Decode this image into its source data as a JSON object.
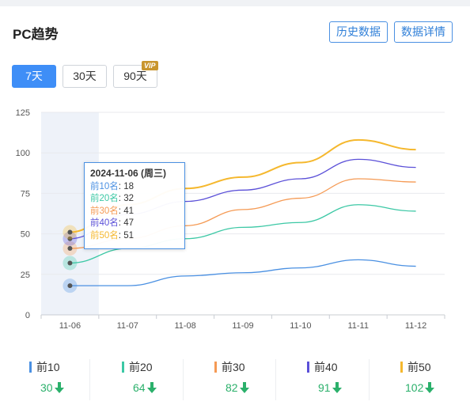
{
  "header": {
    "title": "PC趋势",
    "history_btn": "历史数据",
    "detail_btn": "数据详情"
  },
  "range": {
    "options": [
      "7天",
      "30天",
      "90天"
    ],
    "active": "7天",
    "vip_badge": "VIP"
  },
  "colors": {
    "top10": "#4a90e2",
    "top20": "#3cc8a5",
    "top30": "#f59a54",
    "top40": "#5b50d8",
    "top50": "#f5b82e",
    "primary": "#3e8ef7",
    "down_arrow": "#2bb06b"
  },
  "chart_data": {
    "type": "line",
    "x": [
      "11-06",
      "11-07",
      "11-08",
      "11-09",
      "11-10",
      "11-11",
      "11-12"
    ],
    "ylim": [
      0,
      125
    ],
    "yticks": [
      0,
      25,
      50,
      75,
      100,
      125
    ],
    "highlighted_category": "11-06",
    "series": [
      {
        "name": "前10名",
        "values": [
          18,
          18,
          24,
          26,
          29,
          34,
          30
        ]
      },
      {
        "name": "前20名",
        "values": [
          32,
          41,
          47,
          54,
          57,
          68,
          64
        ]
      },
      {
        "name": "前30名",
        "values": [
          41,
          47,
          55,
          65,
          72,
          84,
          82
        ]
      },
      {
        "name": "前40名",
        "values": [
          47,
          62,
          70,
          77,
          84,
          96,
          91
        ]
      },
      {
        "name": "前50名",
        "values": [
          51,
          68,
          78,
          85,
          94,
          108,
          102
        ]
      }
    ]
  },
  "tooltip": {
    "title": "2024-11-06 (周三)",
    "rows": [
      {
        "label": "前10名",
        "value": "18"
      },
      {
        "label": "前20名",
        "value": "32"
      },
      {
        "label": "前30名",
        "value": "41"
      },
      {
        "label": "前40名",
        "value": "47"
      },
      {
        "label": "前50名",
        "value": "51"
      }
    ]
  },
  "legend": [
    {
      "label": "前10",
      "value": "30",
      "trend": "down"
    },
    {
      "label": "前20",
      "value": "64",
      "trend": "down"
    },
    {
      "label": "前30",
      "value": "82",
      "trend": "down"
    },
    {
      "label": "前40",
      "value": "91",
      "trend": "down"
    },
    {
      "label": "前50",
      "value": "102",
      "trend": "down"
    }
  ]
}
